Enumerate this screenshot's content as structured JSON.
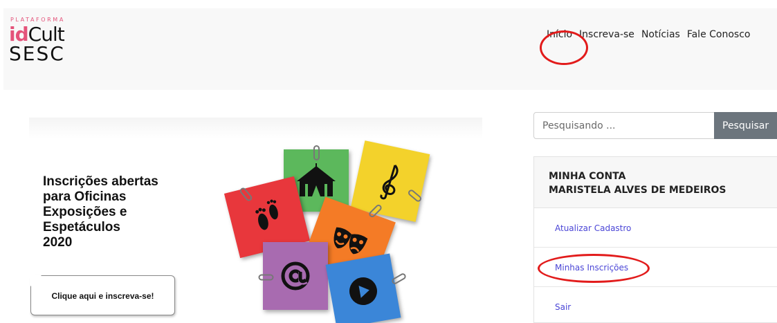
{
  "header": {
    "logo": {
      "small": "PLATAFORMA",
      "id": "id",
      "cult": "Cult",
      "sesc": "SESC"
    },
    "nav": [
      {
        "label": "Início"
      },
      {
        "label": "Inscreva-se"
      },
      {
        "label": "Notícias"
      },
      {
        "label": "Fale Conosco"
      }
    ]
  },
  "banner": {
    "headline_lines": [
      "Inscrições abertas",
      "para Oficinas",
      "Exposições e",
      "Espetáculos",
      "2020"
    ],
    "cta_label": "Clique aqui e inscreva-se!",
    "notes": [
      {
        "icon": "circus-tent-icon",
        "color": "#5cb85c"
      },
      {
        "icon": "treble-clef-icon",
        "color": "#f3d22b"
      },
      {
        "icon": "footprints-icon",
        "color": "#e8373c"
      },
      {
        "icon": "theater-masks-icon",
        "color": "#f47b26"
      },
      {
        "icon": "at-sign-icon",
        "color": "#a86bb0"
      },
      {
        "icon": "play-button-icon",
        "color": "#3b86d8"
      }
    ]
  },
  "search": {
    "placeholder": "Pesquisando ...",
    "button_label": "Pesquisar"
  },
  "account": {
    "title": "MINHA CONTA",
    "user_name": "MARISTELA ALVES DE MEDEIROS",
    "items": [
      {
        "label": "Atualizar Cadastro"
      },
      {
        "label": "Minhas Inscrições"
      },
      {
        "label": "Sair"
      }
    ]
  },
  "colors": {
    "brand_pink": "#e4537a",
    "link": "#4a45d6",
    "annotation_red": "#e21b1b",
    "button_gray": "#6c757d"
  }
}
